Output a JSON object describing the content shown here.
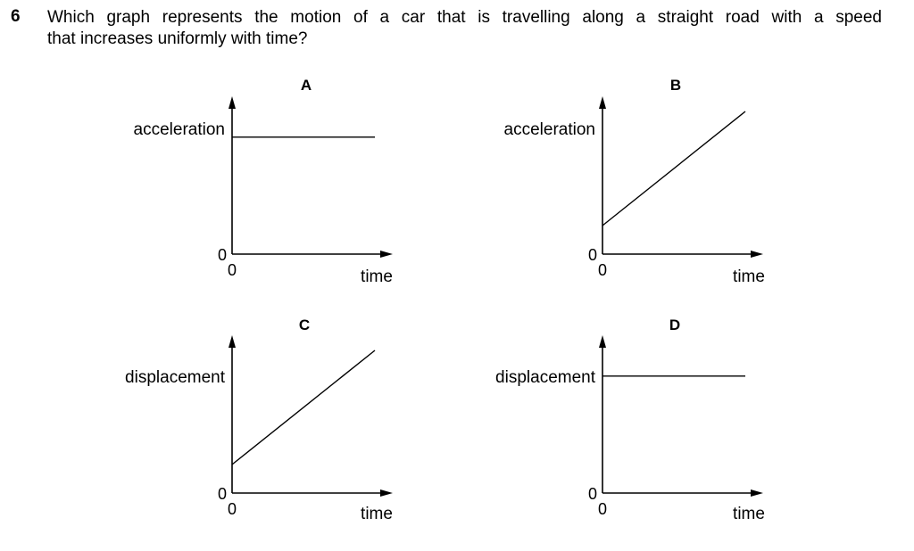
{
  "question": {
    "number": "6",
    "line1": "Which graph represents the motion of a car that is travelling along a straight road with a speed",
    "line2": "that increases uniformly with time?"
  },
  "chart_data": [
    {
      "type": "line",
      "title": "A",
      "xlabel": "time",
      "ylabel": "acceleration",
      "x_origin_label": "0",
      "y_origin_label": "0",
      "shape": "horizontal",
      "series": [
        {
          "x": [
            0,
            1
          ],
          "values": [
            0.82,
            0.82
          ]
        }
      ],
      "xlim": [
        0,
        1.1
      ],
      "ylim": [
        0,
        1.1
      ]
    },
    {
      "type": "line",
      "title": "B",
      "xlabel": "time",
      "ylabel": "acceleration",
      "x_origin_label": "0",
      "y_origin_label": "0",
      "shape": "increasing-with-intercept",
      "series": [
        {
          "x": [
            0,
            1
          ],
          "values": [
            0.2,
            1.0
          ]
        }
      ],
      "xlim": [
        0,
        1.1
      ],
      "ylim": [
        0,
        1.1
      ]
    },
    {
      "type": "line",
      "title": "C",
      "xlabel": "time",
      "ylabel": "displacement",
      "x_origin_label": "0",
      "y_origin_label": "0",
      "shape": "increasing-with-intercept",
      "series": [
        {
          "x": [
            0,
            1
          ],
          "values": [
            0.2,
            1.0
          ]
        }
      ],
      "xlim": [
        0,
        1.1
      ],
      "ylim": [
        0,
        1.1
      ]
    },
    {
      "type": "line",
      "title": "D",
      "xlabel": "time",
      "ylabel": "displacement",
      "x_origin_label": "0",
      "y_origin_label": "0",
      "shape": "horizontal",
      "series": [
        {
          "x": [
            0,
            1
          ],
          "values": [
            0.82,
            0.82
          ]
        }
      ],
      "xlim": [
        0,
        1.1
      ],
      "ylim": [
        0,
        1.1
      ]
    }
  ]
}
